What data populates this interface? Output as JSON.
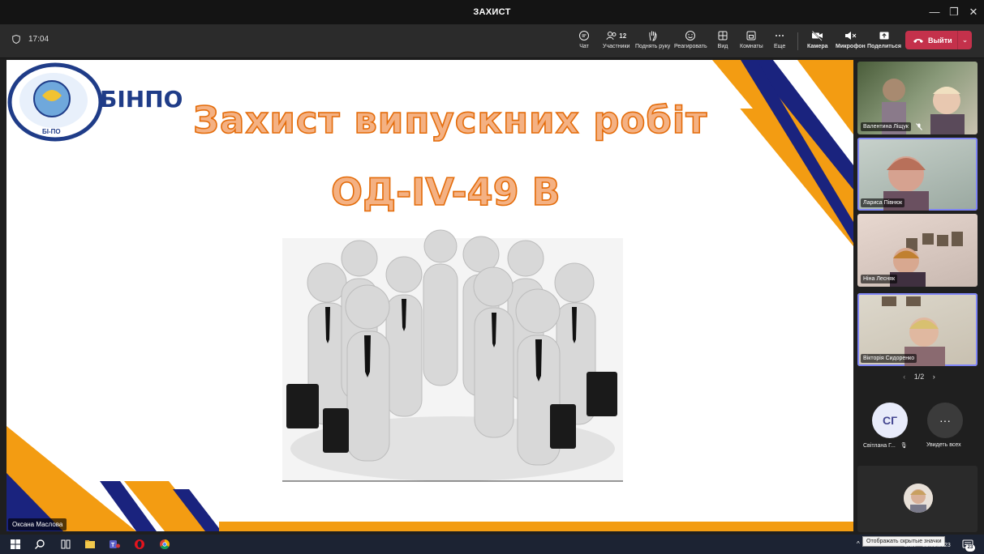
{
  "window": {
    "title": "ЗАХИСТ"
  },
  "toolbar": {
    "timer": "17:04",
    "items": [
      {
        "label": "Чат",
        "icon": "chat-icon"
      },
      {
        "label": "Участники",
        "icon": "people-icon",
        "count": "12"
      },
      {
        "label": "Поднять руку",
        "icon": "hand-icon"
      },
      {
        "label": "Реагировать",
        "icon": "smile-icon"
      },
      {
        "label": "Вид",
        "icon": "layout-icon"
      },
      {
        "label": "Комнаты",
        "icon": "rooms-icon"
      },
      {
        "label": "Еще",
        "icon": "more-icon"
      },
      {
        "label": "Камера",
        "icon": "camera-off-icon"
      },
      {
        "label": "Микрофон",
        "icon": "mic-off-icon"
      },
      {
        "label": "Поделиться",
        "icon": "share-icon"
      }
    ],
    "leave_label": "Выйти"
  },
  "slide": {
    "logo_text": "БІНПО",
    "logo_small": "БІ-ПО",
    "title": "Захист випускних робіт",
    "subtitle": "ОД-IV-49 В",
    "colors": {
      "orange": "#f39c12",
      "navy": "#1a237e",
      "title_fill": "#f4b183",
      "title_stroke": "#e46c0a"
    }
  },
  "presenter": {
    "name": "Оксана Маслова"
  },
  "participants": [
    {
      "name": "Валентина Ліщук",
      "muted": true
    },
    {
      "name": "Лариса Півнюк",
      "active": true
    },
    {
      "name": "Ніна Лесняк"
    },
    {
      "name": "Вікторія Сидоренко",
      "active": true
    }
  ],
  "pager": {
    "label": "1/2"
  },
  "extra": {
    "avatar_initials": "СГ",
    "avatar_name": "Світлана Г...",
    "see_all": "Увидеть всех"
  },
  "taskbar": {
    "tooltip": "Отображать скрытые значки",
    "lang": "UKR",
    "date": "15.09.2023",
    "badge": "23"
  }
}
